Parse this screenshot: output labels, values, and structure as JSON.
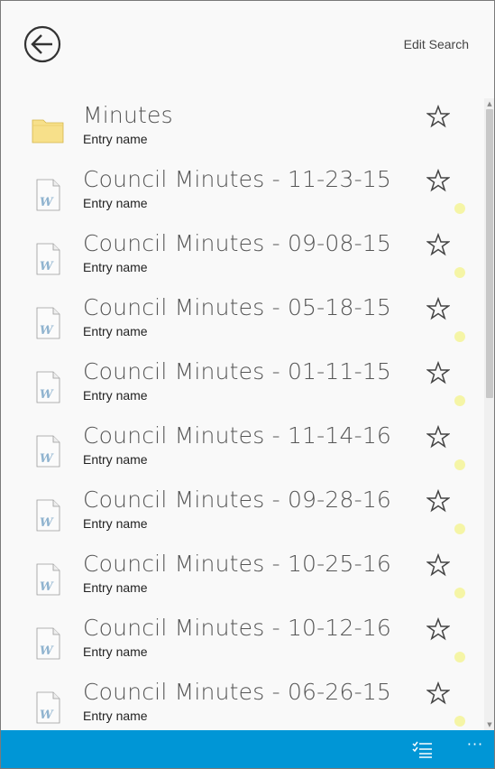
{
  "header": {
    "edit_search_label": "Edit Search"
  },
  "colors": {
    "bottom_bar": "#0096d6",
    "dot_marker": "#f5f5a6",
    "folder": "#f7e08a"
  },
  "entries": [
    {
      "title": "Minutes",
      "subtitle": "Entry name",
      "type": "folder",
      "icon": "folder-icon",
      "has_dot": false
    },
    {
      "title": "Council Minutes - 11-23-15",
      "subtitle": "Entry name",
      "type": "document",
      "icon": "word-document-icon",
      "has_dot": true
    },
    {
      "title": "Council Minutes - 09-08-15",
      "subtitle": "Entry name",
      "type": "document",
      "icon": "word-document-icon",
      "has_dot": true
    },
    {
      "title": "Council Minutes - 05-18-15",
      "subtitle": "Entry name",
      "type": "document",
      "icon": "word-document-icon",
      "has_dot": true
    },
    {
      "title": "Council Minutes - 01-11-15",
      "subtitle": "Entry name",
      "type": "document",
      "icon": "word-document-icon",
      "has_dot": true
    },
    {
      "title": "Council Minutes - 11-14-16",
      "subtitle": "Entry name",
      "type": "document",
      "icon": "word-document-icon",
      "has_dot": true
    },
    {
      "title": "Council Minutes - 09-28-16",
      "subtitle": "Entry name",
      "type": "document",
      "icon": "word-document-icon",
      "has_dot": true
    },
    {
      "title": "Council Minutes - 10-25-16",
      "subtitle": "Entry name",
      "type": "document",
      "icon": "word-document-icon",
      "has_dot": true
    },
    {
      "title": "Council Minutes - 10-12-16",
      "subtitle": "Entry name",
      "type": "document",
      "icon": "word-document-icon",
      "has_dot": true
    },
    {
      "title": "Council Minutes - 06-26-15",
      "subtitle": "Entry name",
      "type": "document",
      "icon": "word-document-icon",
      "has_dot": true
    }
  ],
  "bottom_bar": {
    "more_label": "···"
  }
}
